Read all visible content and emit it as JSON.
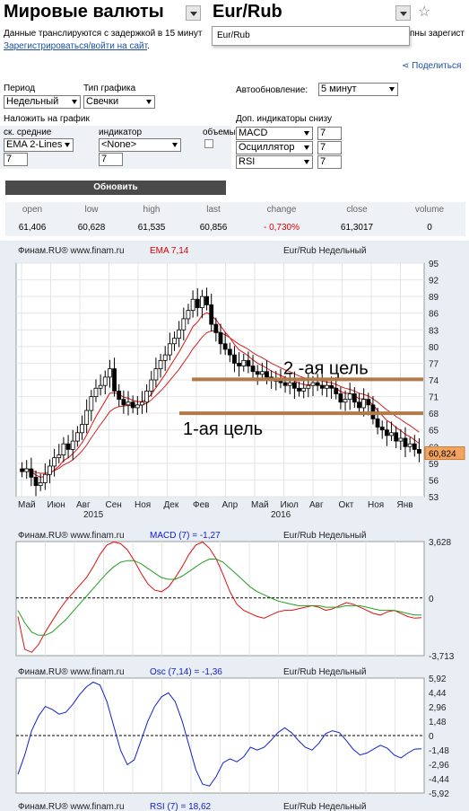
{
  "header": {
    "title": "Мировые валюты",
    "pair": "Eur/Rub",
    "delay_notice": "Данные транслируются с задержкой в 15 минут",
    "notice_tail": "пны зарегист",
    "register_link": "Зарегистрироваться/войти на сайт",
    "register_dot": ".",
    "search_value": "Eur/Rub",
    "share_label": "Поделиться"
  },
  "controls": {
    "period_label": "Период",
    "period_value": "Недельный",
    "chart_type_label": "Тип графика",
    "chart_type_value": "Свечки",
    "autoupdate_label": "Автообновление:",
    "autoupdate_value": "5 минут",
    "overlay_label": "Наложить на график",
    "ma_label": "ск. средние",
    "ma_value": "EMA 2-Lines",
    "ma_param": "7",
    "indicator_label": "индикатор",
    "indicator_value": "<None>",
    "indicator_param": "7",
    "volumes_label": "объемы",
    "extra_label": "Доп. индикаторы снизу",
    "extra": [
      {
        "value": "MACD",
        "param": "7"
      },
      {
        "value": "Осциллятор",
        "param": "7"
      },
      {
        "value": "RSI",
        "param": "7"
      }
    ],
    "update_button": "Обновить"
  },
  "stats": {
    "headers": [
      "open",
      "low",
      "high",
      "last",
      "change",
      "close",
      "volume"
    ],
    "values": [
      "61,406",
      "60,628",
      "61,535",
      "60,856",
      "- 0,730%",
      "61,3017",
      "0"
    ]
  },
  "colors": {
    "candle_up": "#ffffff",
    "candle_down": "#000000",
    "ema_fast": "#e01010",
    "ema_slow": "#d02020",
    "macd": "#e01010",
    "signal": "#20a020",
    "osc": "#1020d0",
    "target_line": "#b07a4a",
    "price_tag": "#f4a460"
  },
  "chart_data": [
    {
      "type": "candlestick",
      "source": "Финам.RU® www.finam.ru",
      "indicator_label": "EMA 7,14",
      "title": "Eur/Rub Недельный",
      "x_ticks": [
        "Май",
        "Июн",
        "Авг",
        "Сен",
        "Ноя",
        "Дек",
        "Фев",
        "Апр",
        "Май",
        "Июл",
        "Авг",
        "Окт",
        "Ноя",
        "Янв"
      ],
      "year_labels": [
        "2015",
        "2016"
      ],
      "y_ticks": [
        53,
        56,
        59,
        62,
        65,
        68,
        71,
        74,
        77,
        80,
        83,
        86,
        89,
        92,
        95
      ],
      "ylim": [
        53,
        95
      ],
      "last_price": "60,824",
      "annotations": [
        {
          "text": "2 -ая цель",
          "level": 74.1
        },
        {
          "text": "1-ая цель",
          "level": 68.0
        }
      ],
      "close": [
        57.5,
        58.0,
        56.5,
        55.0,
        55.5,
        57.0,
        58.5,
        60.0,
        60.5,
        62.5,
        61.5,
        63.0,
        64.5,
        66.0,
        68.5,
        71.0,
        72.5,
        73.0,
        74.5,
        76.0,
        72.0,
        70.5,
        69.5,
        70.0,
        69.0,
        69.5,
        70.0,
        72.0,
        74.0,
        76.0,
        77.5,
        78.5,
        80.5,
        81.5,
        83.0,
        85.0,
        86.5,
        88.5,
        87.0,
        89.0,
        87.5,
        84.0,
        82.5,
        80.5,
        79.5,
        78.5,
        77.0,
        76.5,
        77.5,
        76.5,
        75.5,
        75.0,
        75.5,
        74.5,
        74.0,
        74.0,
        73.5,
        73.0,
        73.5,
        72.5,
        72.0,
        72.5,
        73.0,
        73.5,
        73.0,
        72.5,
        73.0,
        72.5,
        71.5,
        70.0,
        70.5,
        71.5,
        70.0,
        69.0,
        70.5,
        69.5,
        67.0,
        65.5,
        65.0,
        64.0,
        64.5,
        63.0,
        63.5,
        62.0,
        62.5,
        61.5,
        60.8
      ],
      "ema_fast": [
        58.0,
        58.0,
        57.5,
        56.9,
        56.5,
        56.6,
        57.1,
        57.8,
        58.5,
        59.5,
        60.0,
        60.7,
        61.6,
        62.7,
        64.1,
        65.8,
        67.4,
        68.8,
        70.2,
        71.6,
        71.7,
        71.4,
        70.9,
        70.7,
        70.3,
        70.1,
        70.1,
        70.6,
        71.4,
        72.6,
        73.8,
        75.0,
        76.4,
        77.7,
        79.0,
        80.5,
        82.0,
        83.6,
        84.4,
        85.6,
        86.1,
        85.6,
        84.8,
        83.7,
        82.6,
        81.6,
        80.4,
        79.4,
        78.9,
        78.3,
        77.6,
        77.0,
        76.6,
        76.1,
        75.6,
        75.2,
        74.8,
        74.4,
        74.2,
        73.8,
        73.4,
        73.2,
        73.1,
        73.2,
        73.1,
        73.0,
        73.0,
        72.9,
        72.5,
        71.9,
        71.6,
        71.6,
        71.2,
        70.6,
        70.6,
        70.3,
        69.5,
        68.5,
        67.6,
        66.7,
        66.2,
        65.4,
        64.9,
        64.2,
        63.8,
        63.2,
        62.6
      ],
      "ema_slow": [
        58.0,
        58.0,
        57.8,
        57.4,
        57.2,
        57.2,
        57.3,
        57.7,
        58.1,
        58.7,
        59.1,
        59.6,
        60.4,
        61.2,
        62.3,
        63.6,
        64.8,
        66.0,
        67.1,
        68.3,
        68.9,
        69.2,
        69.3,
        69.4,
        69.4,
        69.4,
        69.5,
        69.8,
        70.4,
        71.2,
        72.0,
        72.9,
        73.9,
        74.9,
        75.9,
        77.1,
        78.3,
        79.6,
        80.6,
        81.7,
        82.5,
        82.8,
        82.8,
        82.5,
        82.1,
        81.6,
        81.0,
        80.4,
        80.0,
        79.5,
        78.9,
        78.4,
        78.0,
        77.5,
        77.0,
        76.6,
        76.2,
        75.8,
        75.5,
        75.1,
        74.7,
        74.4,
        74.2,
        74.1,
        73.9,
        73.8,
        73.6,
        73.5,
        73.2,
        72.8,
        72.5,
        72.3,
        72.0,
        71.6,
        71.4,
        71.1,
        70.6,
        70.0,
        69.3,
        68.6,
        68.1,
        67.4,
        66.9,
        66.3,
        65.8,
        65.2,
        64.6
      ]
    },
    {
      "type": "line",
      "source": "Финам.RU® www.finam.ru",
      "indicator_label": "MACD (7) = -1,27",
      "title": "Eur/Rub Недельный",
      "y_ticks": [
        "3,628",
        "0",
        "-3,713"
      ],
      "ylim": [
        -3.713,
        3.628
      ],
      "series": [
        {
          "values": [
            -1.2,
            -3.3,
            -3.5,
            -3.0,
            -2.2,
            -1.5,
            -0.8,
            -0.2,
            0.3,
            0.8,
            1.3,
            2.0,
            2.8,
            3.4,
            3.6,
            3.5,
            3.1,
            2.4,
            1.6,
            0.9,
            0.5,
            0.4,
            0.7,
            1.3,
            2.0,
            2.8,
            3.4,
            3.6,
            3.2,
            2.5,
            1.5,
            0.4,
            -0.4,
            -0.8,
            -1.0,
            -1.2,
            -1.3,
            -1.1,
            -0.9,
            -0.8,
            -0.8,
            -0.7,
            -0.6,
            -0.5,
            -0.6,
            -0.8,
            -0.7,
            -0.5,
            -0.3,
            -0.4,
            -0.6,
            -0.8,
            -1.0,
            -1.1,
            -0.9,
            -0.8,
            -1.0,
            -1.2,
            -1.3,
            -1.27
          ]
        },
        {
          "values": [
            -0.8,
            -1.6,
            -2.2,
            -2.4,
            -2.4,
            -2.2,
            -1.8,
            -1.4,
            -0.9,
            -0.4,
            0.1,
            0.6,
            1.1,
            1.6,
            2.0,
            2.3,
            2.4,
            2.4,
            2.2,
            1.9,
            1.6,
            1.3,
            1.2,
            1.2,
            1.4,
            1.7,
            2.0,
            2.3,
            2.5,
            2.5,
            2.3,
            1.9,
            1.5,
            1.1,
            0.7,
            0.4,
            0.2,
            0.0,
            -0.2,
            -0.3,
            -0.4,
            -0.5,
            -0.5,
            -0.5,
            -0.5,
            -0.6,
            -0.6,
            -0.6,
            -0.5,
            -0.5,
            -0.5,
            -0.6,
            -0.7,
            -0.8,
            -0.8,
            -0.8,
            -0.9,
            -1.0,
            -1.1,
            -1.1
          ]
        }
      ]
    },
    {
      "type": "line",
      "source": "Финам.RU® www.finam.ru",
      "indicator_label": "Osc (7,14) = -1,36",
      "title": "Eur/Rub Недельный",
      "y_ticks": [
        "5,92",
        "4,44",
        "2,96",
        "1,48",
        "0",
        "-1,48",
        "-2,96",
        "-4,44",
        "-5,92"
      ],
      "ylim": [
        -5.92,
        5.92
      ],
      "series": [
        {
          "values": [
            -4.0,
            -2.0,
            0.5,
            2.0,
            3.0,
            2.7,
            2.2,
            2.4,
            3.2,
            4.2,
            5.0,
            5.5,
            5.2,
            3.5,
            1.0,
            -1.5,
            -3.0,
            -2.5,
            -0.5,
            1.5,
            3.0,
            4.0,
            4.4,
            3.5,
            1.5,
            -1.0,
            -3.5,
            -5.0,
            -5.2,
            -4.2,
            -2.8,
            -2.4,
            -2.7,
            -2.2,
            -1.2,
            -1.5,
            -1.2,
            -0.5,
            0.3,
            0.8,
            0.3,
            -0.5,
            -1.2,
            -1.5,
            -0.8,
            0.2,
            0.5,
            0.3,
            -0.5,
            -1.4,
            -2.0,
            -1.8,
            -1.4,
            -1.0,
            -1.3,
            -2.0,
            -2.3,
            -1.8,
            -1.4,
            -1.36
          ]
        }
      ]
    },
    {
      "type": "line",
      "source": "Финам.RU® www.finam.ru",
      "indicator_label": "RSI (7) = 18,62",
      "title": "Eur/Rub Недельный"
    }
  ]
}
